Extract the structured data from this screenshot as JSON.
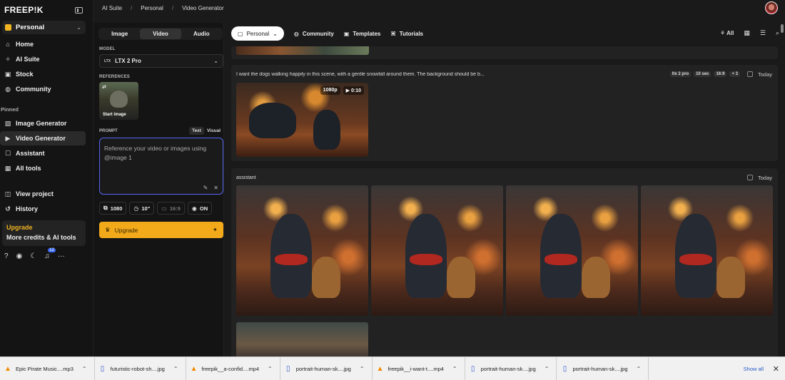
{
  "app": {
    "logo": "FREEP!K"
  },
  "sidebar": {
    "workspace": "Personal",
    "nav": [
      {
        "label": "Home",
        "icon": "home-icon"
      },
      {
        "label": "AI Suite",
        "icon": "sparkle-icon"
      },
      {
        "label": "Stock",
        "icon": "image-icon"
      },
      {
        "label": "Community",
        "icon": "globe-icon"
      }
    ],
    "pinned_title": "Pinned",
    "pinned": [
      {
        "label": "Image Generator",
        "icon": "image-generator-icon"
      },
      {
        "label": "Video Generator",
        "icon": "video-generator-icon",
        "active": true
      },
      {
        "label": "Assistant",
        "icon": "assistant-icon"
      },
      {
        "label": "All tools",
        "icon": "grid-icon"
      }
    ],
    "extra": [
      {
        "label": "View project",
        "icon": "project-icon"
      },
      {
        "label": "History",
        "icon": "history-icon"
      }
    ],
    "upgrade_title": "Upgrade",
    "upgrade_sub": "More credits & AI tools",
    "notification_count": "12"
  },
  "breadcrumb": [
    "AI Suite",
    "Personal",
    "Video Generator"
  ],
  "tool": {
    "tabs": [
      "Image",
      "Video",
      "Audio"
    ],
    "active_tab": "Video",
    "model_label": "MODEL",
    "model_icon_text": "LTX",
    "model_value": "LTX 2 Pro",
    "references_label": "REFERENCES",
    "ref_caption": "Start image",
    "prompt_label": "PROMPT",
    "prompt_modes": [
      "Text",
      "Visual"
    ],
    "prompt_placeholder": "Reference your video or images using @image 1",
    "settings": [
      {
        "label": "1080",
        "icon": "resolution-icon"
      },
      {
        "label": "10\"",
        "icon": "duration-icon"
      },
      {
        "label": "16:9",
        "icon": "ratio-icon",
        "dim": true
      },
      {
        "label": "ON",
        "icon": "audio-icon"
      }
    ],
    "upgrade_button": "Upgrade"
  },
  "filters": {
    "workspace": "Personal",
    "items": [
      "Community",
      "Templates",
      "Tutorials"
    ],
    "all_label": "All"
  },
  "feed": {
    "card1": {
      "prompt": "I want the dogs walking happily in this scene, with a gentle snowfall around them. The background should be b...",
      "tags": [
        "ltx 2 pro",
        "10 sec",
        "16:9",
        "+ 3"
      ],
      "date": "Today",
      "badges": [
        "1080p",
        "▶ 0:10"
      ]
    },
    "card2": {
      "author": "assistant",
      "date": "Today"
    }
  },
  "downloads": [
    {
      "name": "Epic Pirate Music....mp3",
      "type": "cone"
    },
    {
      "name": "futuristic-robot-sh....jpg",
      "type": "file"
    },
    {
      "name": "freepik__a-confid....mp4",
      "type": "cone"
    },
    {
      "name": "portrait-human-sk....jpg",
      "type": "file"
    },
    {
      "name": "freepik__i-want-t....mp4",
      "type": "cone"
    },
    {
      "name": "portrait-human-sk....jpg",
      "type": "file"
    },
    {
      "name": "portrait-human-sk....jpg",
      "type": "file"
    }
  ],
  "downloads_show_all": "Show all",
  "colors": {
    "accent": "#f2a91a",
    "focus": "#5567f0",
    "bg": "#1a1a1a"
  }
}
